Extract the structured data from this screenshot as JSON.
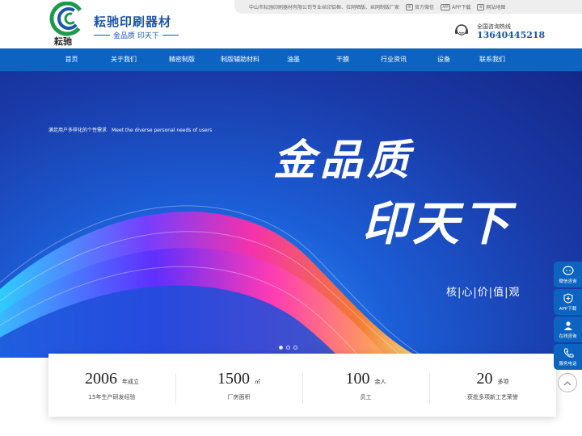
{
  "topbar": {
    "intro": "中山市耘驰印刷器材有限公司专业丝印铝框、拉网晒版、丝网制版厂家",
    "links": [
      {
        "label": "官方微信",
        "icon": "wechat-icon"
      },
      {
        "label": "APP下载",
        "icon": "app-icon"
      },
      {
        "label": "网站地图",
        "icon": "sitemap-icon"
      }
    ],
    "app_badge": "APP"
  },
  "header": {
    "logo_text": "耘驰",
    "brand": "耘驰印刷器材",
    "slogan": "金品质  印天下",
    "hotline_label": "全国咨询热线",
    "hotline_number": "13640445218"
  },
  "nav": {
    "items": [
      "首页",
      "关于我们",
      "精密制版",
      "制版辅助材料",
      "油墨",
      "干膜",
      "行业资讯",
      "设备",
      "联系我们"
    ]
  },
  "banner": {
    "tag_cn": "满足用户多样化的个性需求",
    "tag_en": "Meet the diverse personal needs of users",
    "calligraphy_line1": "金品质",
    "calligraphy_line2": "印天下",
    "values": "核|心|价|值|观",
    "dots": 3
  },
  "stats": [
    {
      "num": "2006",
      "unit": "年成立",
      "desc": "15年生产研发经验"
    },
    {
      "num": "1500",
      "unit": "㎡",
      "desc": "厂房面积"
    },
    {
      "num": "100",
      "unit": "余人",
      "desc": "员工"
    },
    {
      "num": "20",
      "unit": "多项",
      "desc": "获批多项新工艺荣誉"
    }
  ],
  "side": [
    {
      "label": "微信咨询",
      "icon": "wechat-icon"
    },
    {
      "label": "APP下载",
      "icon": "app-download-icon"
    },
    {
      "label": "在线咨询",
      "icon": "user-chat-icon"
    },
    {
      "label": "服务电话",
      "icon": "phone-icon"
    }
  ],
  "colors": {
    "primary": "#0c64c0",
    "brand": "#1b56a8",
    "logo_green": "#1a9a4a"
  }
}
